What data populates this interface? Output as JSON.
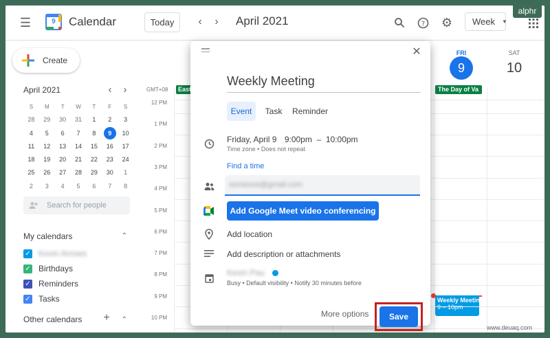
{
  "header": {
    "app_title": "Calendar",
    "logo_day": "9",
    "today_label": "Today",
    "month_title": "April 2021",
    "view_label": "Week"
  },
  "brand_badge": "alphr",
  "watermark": "www.deuaq.com",
  "sidebar": {
    "create_label": "Create",
    "mini_calendar": {
      "title": "April 2021",
      "weekdays": [
        "S",
        "M",
        "T",
        "W",
        "T",
        "F",
        "S"
      ],
      "weeks": [
        [
          "28",
          "29",
          "30",
          "31",
          "1",
          "2",
          "3"
        ],
        [
          "4",
          "5",
          "6",
          "7",
          "8",
          "9",
          "10"
        ],
        [
          "11",
          "12",
          "13",
          "14",
          "15",
          "16",
          "17"
        ],
        [
          "18",
          "19",
          "20",
          "21",
          "22",
          "23",
          "24"
        ],
        [
          "25",
          "26",
          "27",
          "28",
          "29",
          "30",
          "1"
        ],
        [
          "2",
          "3",
          "4",
          "5",
          "6",
          "7",
          "8"
        ]
      ],
      "selected_day": "9"
    },
    "search_people_placeholder": "Search for people",
    "my_calendars_label": "My calendars",
    "calendars": [
      {
        "label": "Kevin Arrows",
        "color": "#039be5",
        "blurred": true
      },
      {
        "label": "Birthdays",
        "color": "#33b679",
        "blurred": false
      },
      {
        "label": "Reminders",
        "color": "#3f51b5",
        "blurred": false
      },
      {
        "label": "Tasks",
        "color": "#4285f4",
        "blurred": false
      }
    ],
    "other_calendars_label": "Other calendars"
  },
  "grid": {
    "timezone": "GMT+08",
    "times": [
      "12 PM",
      "1 PM",
      "2 PM",
      "3 PM",
      "4 PM",
      "5 PM",
      "6 PM",
      "7 PM",
      "8 PM",
      "9 PM",
      "10 PM"
    ],
    "days": [
      {
        "dow": "FRI",
        "date": "9",
        "today": true
      },
      {
        "dow": "SAT",
        "date": "10",
        "today": false
      }
    ],
    "allday_left": "East",
    "allday_fri": "The Day of Va",
    "event": {
      "title": "Weekly Meetin",
      "time": "9 – 10pm"
    }
  },
  "dialog": {
    "title_value": "Weekly Meeting",
    "tabs": [
      "Event",
      "Task",
      "Reminder"
    ],
    "active_tab": "Event",
    "date_text": "Friday, April 9",
    "time_text": "9:00pm  –  10:00pm",
    "timezone_text": "Time zone • Does not repeat",
    "find_time": "Find a time",
    "guest_value": "someone@gmail.com",
    "meet_button": "Add Google Meet video conferencing",
    "location_placeholder": "Add location",
    "description_placeholder": "Add description or attachments",
    "owner_name": "Kevin Pau",
    "status_text": "Busy • Default visibility • Notify 30 minutes before",
    "more_options": "More options",
    "save_label": "Save"
  }
}
